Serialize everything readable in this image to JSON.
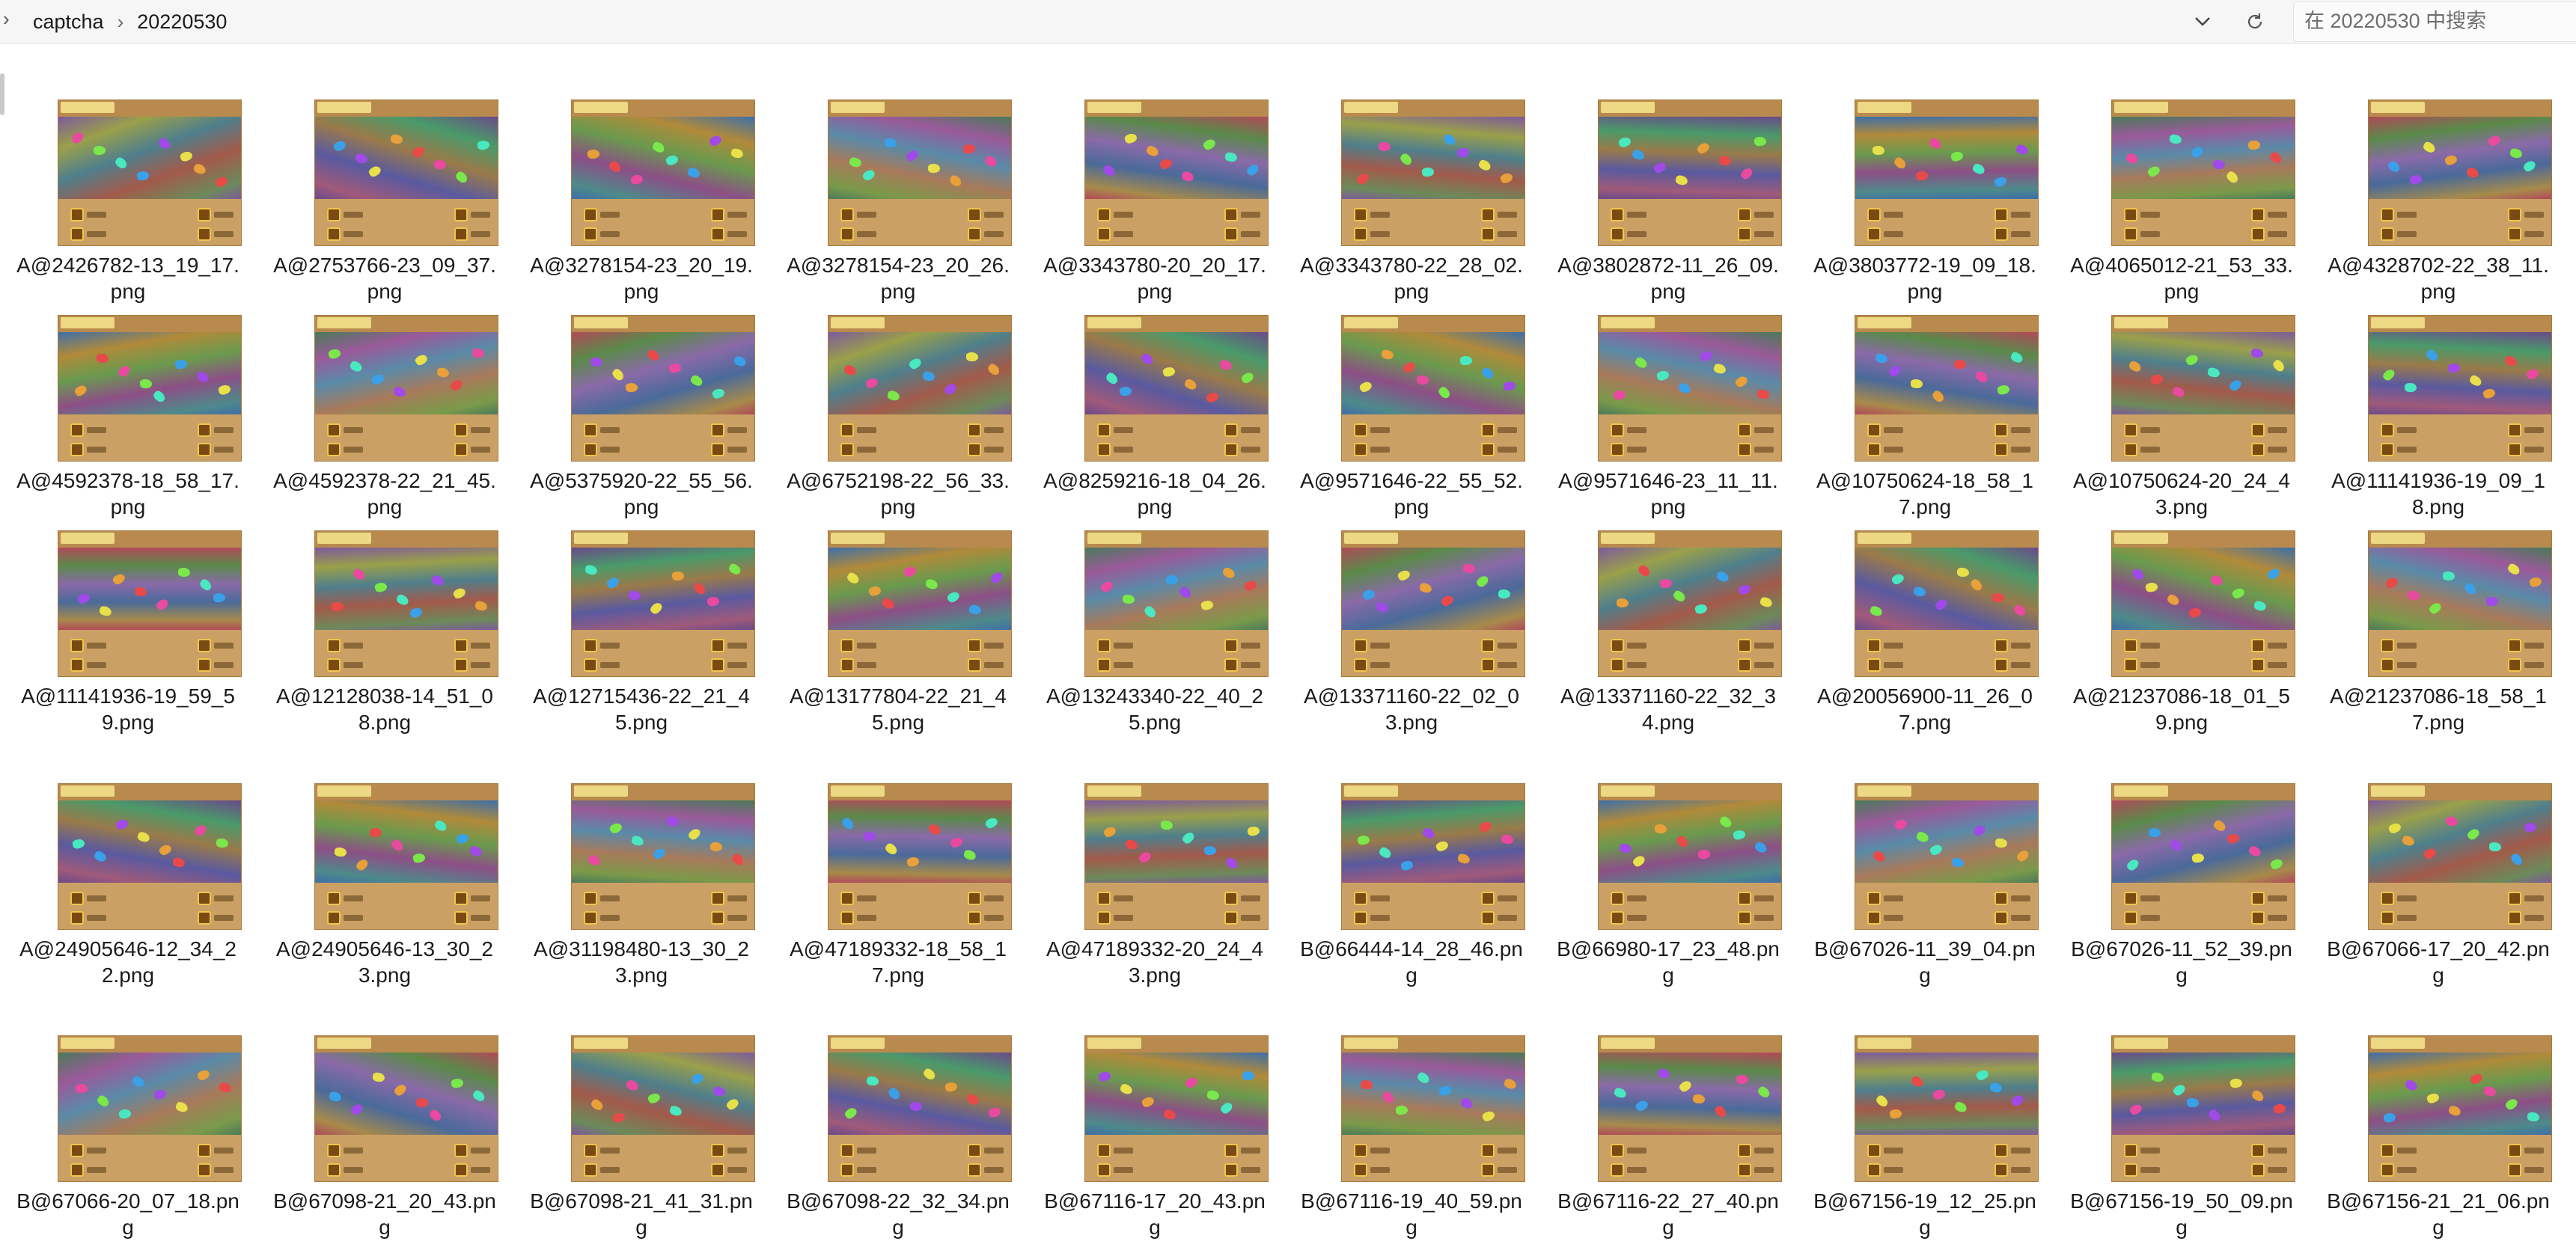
{
  "breadcrumb": [
    "captcha",
    "20220530"
  ],
  "search": {
    "placeholder": "在 20220530 中搜索"
  },
  "files": [
    [
      "A@2426782-13_19_17.",
      "png"
    ],
    [
      "A@2753766-23_09_37.",
      "png"
    ],
    [
      "A@3278154-23_20_19.",
      "png"
    ],
    [
      "A@3278154-23_20_26.",
      "png"
    ],
    [
      "A@3343780-20_20_17.",
      "png"
    ],
    [
      "A@3343780-22_28_02.",
      "png"
    ],
    [
      "A@3802872-11_26_09.",
      "png"
    ],
    [
      "A@3803772-19_09_18.",
      "png"
    ],
    [
      "A@4065012-21_53_33.",
      "png"
    ],
    [
      "A@4328702-22_38_11.",
      "png"
    ],
    [
      "A@4592378-18_58_17.",
      "png"
    ],
    [
      "A@4592378-22_21_45.",
      "png"
    ],
    [
      "A@5375920-22_55_56.",
      "png"
    ],
    [
      "A@6752198-22_56_33.",
      "png"
    ],
    [
      "A@8259216-18_04_26.",
      "png"
    ],
    [
      "A@9571646-22_55_52.",
      "png"
    ],
    [
      "A@9571646-23_11_11.",
      "png"
    ],
    [
      "A@10750624-18_58_1",
      "7.png"
    ],
    [
      "A@10750624-20_24_4",
      "3.png"
    ],
    [
      "A@11141936-19_09_1",
      "8.png"
    ],
    [
      "A@11141936-19_59_5",
      "9.png"
    ],
    [
      "A@12128038-14_51_0",
      "8.png"
    ],
    [
      "A@12715436-22_21_4",
      "5.png"
    ],
    [
      "A@13177804-22_21_4",
      "5.png"
    ],
    [
      "A@13243340-22_40_2",
      "5.png"
    ],
    [
      "A@13371160-22_02_0",
      "3.png"
    ],
    [
      "A@13371160-22_32_3",
      "4.png"
    ],
    [
      "A@20056900-11_26_0",
      "7.png"
    ],
    [
      "A@21237086-18_01_5",
      "9.png"
    ],
    [
      "A@21237086-18_58_1",
      "7.png"
    ],
    [
      "A@24905646-12_34_2",
      "2.png"
    ],
    [
      "A@24905646-13_30_2",
      "3.png"
    ],
    [
      "A@31198480-13_30_2",
      "3.png"
    ],
    [
      "A@47189332-18_58_1",
      "7.png"
    ],
    [
      "A@47189332-20_24_4",
      "3.png"
    ],
    [
      "B@66444-14_28_46.pn",
      "g"
    ],
    [
      "B@66980-17_23_48.pn",
      "g"
    ],
    [
      "B@67026-11_39_04.pn",
      "g"
    ],
    [
      "B@67026-11_52_39.pn",
      "g"
    ],
    [
      "B@67066-17_20_42.pn",
      "g"
    ],
    [
      "B@67066-20_07_18.pn",
      "g"
    ],
    [
      "B@67098-21_20_43.pn",
      "g"
    ],
    [
      "B@67098-21_41_31.pn",
      "g"
    ],
    [
      "B@67098-22_32_34.pn",
      "g"
    ],
    [
      "B@67116-17_20_43.pn",
      "g"
    ],
    [
      "B@67116-19_40_59.pn",
      "g"
    ],
    [
      "B@67116-22_27_40.pn",
      "g"
    ],
    [
      "B@67156-19_12_25.pn",
      "g"
    ],
    [
      "B@67156-19_50_09.pn",
      "g"
    ],
    [
      "B@67156-21_21_06.pn",
      "g"
    ]
  ]
}
